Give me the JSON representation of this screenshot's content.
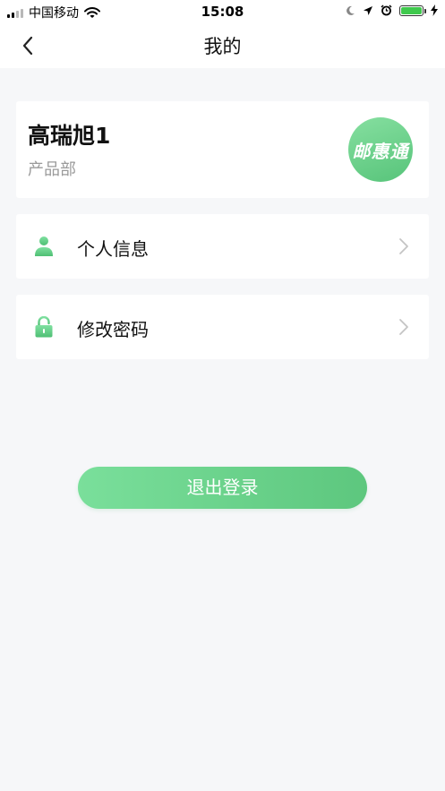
{
  "status_bar": {
    "carrier": "中国移动",
    "time": "15:08",
    "battery_color": "#3fc94d"
  },
  "nav": {
    "title": "我的",
    "back_icon": "chevron-left-icon"
  },
  "profile": {
    "name": "高瑞旭1",
    "department": "产品部",
    "logo_text": "邮惠通"
  },
  "menu": {
    "items": [
      {
        "label": "个人信息",
        "icon": "user-icon"
      },
      {
        "label": "修改密码",
        "icon": "lock-icon"
      }
    ]
  },
  "logout": {
    "label": "退出登录"
  },
  "colors": {
    "accent": "#5dc77e",
    "background": "#f6f7f9",
    "muted_text": "#9a9a9a"
  }
}
